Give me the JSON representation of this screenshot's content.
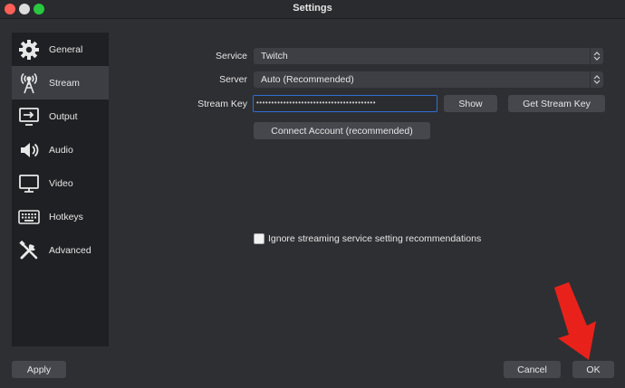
{
  "window": {
    "title": "Settings"
  },
  "sidebar": {
    "items": [
      {
        "label": "General",
        "icon": "gear-icon"
      },
      {
        "label": "Stream",
        "icon": "broadcast-icon",
        "active": true
      },
      {
        "label": "Output",
        "icon": "output-icon"
      },
      {
        "label": "Audio",
        "icon": "speaker-icon"
      },
      {
        "label": "Video",
        "icon": "monitor-icon"
      },
      {
        "label": "Hotkeys",
        "icon": "keyboard-icon"
      },
      {
        "label": "Advanced",
        "icon": "tools-icon"
      }
    ]
  },
  "stream": {
    "service_label": "Service",
    "service_value": "Twitch",
    "server_label": "Server",
    "server_value": "Auto (Recommended)",
    "key_label": "Stream Key",
    "key_value": "••••••••••••••••••••••••••••••••••••••••",
    "show_button": "Show",
    "get_key_button": "Get Stream Key",
    "connect_button": "Connect Account (recommended)",
    "ignore_checkbox_label": "Ignore streaming service setting recommendations",
    "ignore_checked": false
  },
  "footer": {
    "apply": "Apply",
    "cancel": "Cancel",
    "ok": "OK"
  },
  "colors": {
    "annotation_arrow": "#e8221b",
    "focus_border": "#2f6fd3"
  }
}
